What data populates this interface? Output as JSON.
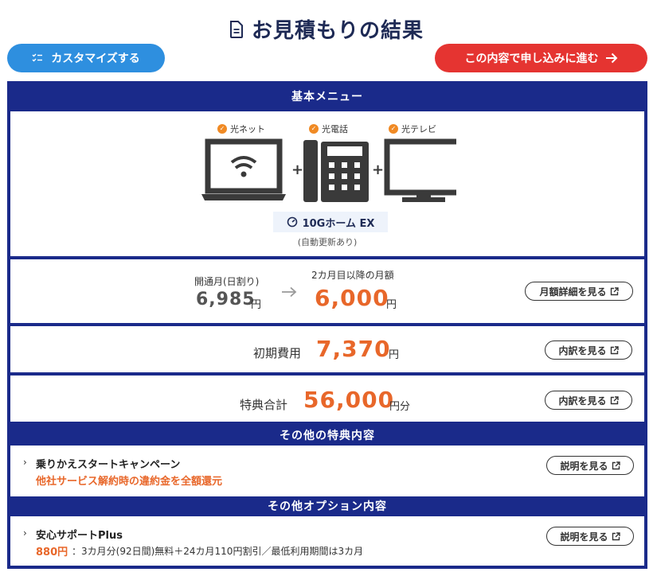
{
  "page_title": "お見積もりの結果",
  "buttons": {
    "customize": "カスタマイズする",
    "apply": "この内容で申し込みに進む"
  },
  "basic_menu": {
    "header": "基本メニュー",
    "services": [
      "光ネット",
      "光電話",
      "光テレビ"
    ],
    "plus_sign": "+",
    "plan_name": "10Gホーム EX",
    "auto_renew": "(自動更新あり)"
  },
  "monthly": {
    "first_month_label": "開通月(日割り)",
    "first_month_value": "6,985",
    "first_month_unit": "円",
    "later_label": "2カ月目以降の月額",
    "later_value": "6,000",
    "later_unit": "円",
    "details_button": "月額詳細を見る"
  },
  "initial_cost": {
    "label": "初期費用",
    "value": "7,370",
    "unit": "円",
    "button": "内訳を見る"
  },
  "bonus_total": {
    "label": "特典合計",
    "value": "56,000",
    "unit": "円分",
    "button": "内訳を見る"
  },
  "other_benefits": {
    "header": "その他の特典内容",
    "items": [
      {
        "title": "乗りかえスタートキャンペーン",
        "highlight": "他社サービス解約時の違約金を全額還元",
        "button": "説明を見る"
      }
    ]
  },
  "other_options": {
    "header": "その他オプション内容",
    "items": [
      {
        "title": "安心サポートPlus",
        "price": "880円",
        "note": "：3カ月分(92日間)無料＋24カ月110円割引／最低利用期間は3カ月",
        "button": "説明を見る"
      }
    ]
  },
  "colors": {
    "navy": "#1a2a8a",
    "blue_button": "#2e8fdf",
    "red_button": "#e53431",
    "orange": "#e8672a"
  }
}
